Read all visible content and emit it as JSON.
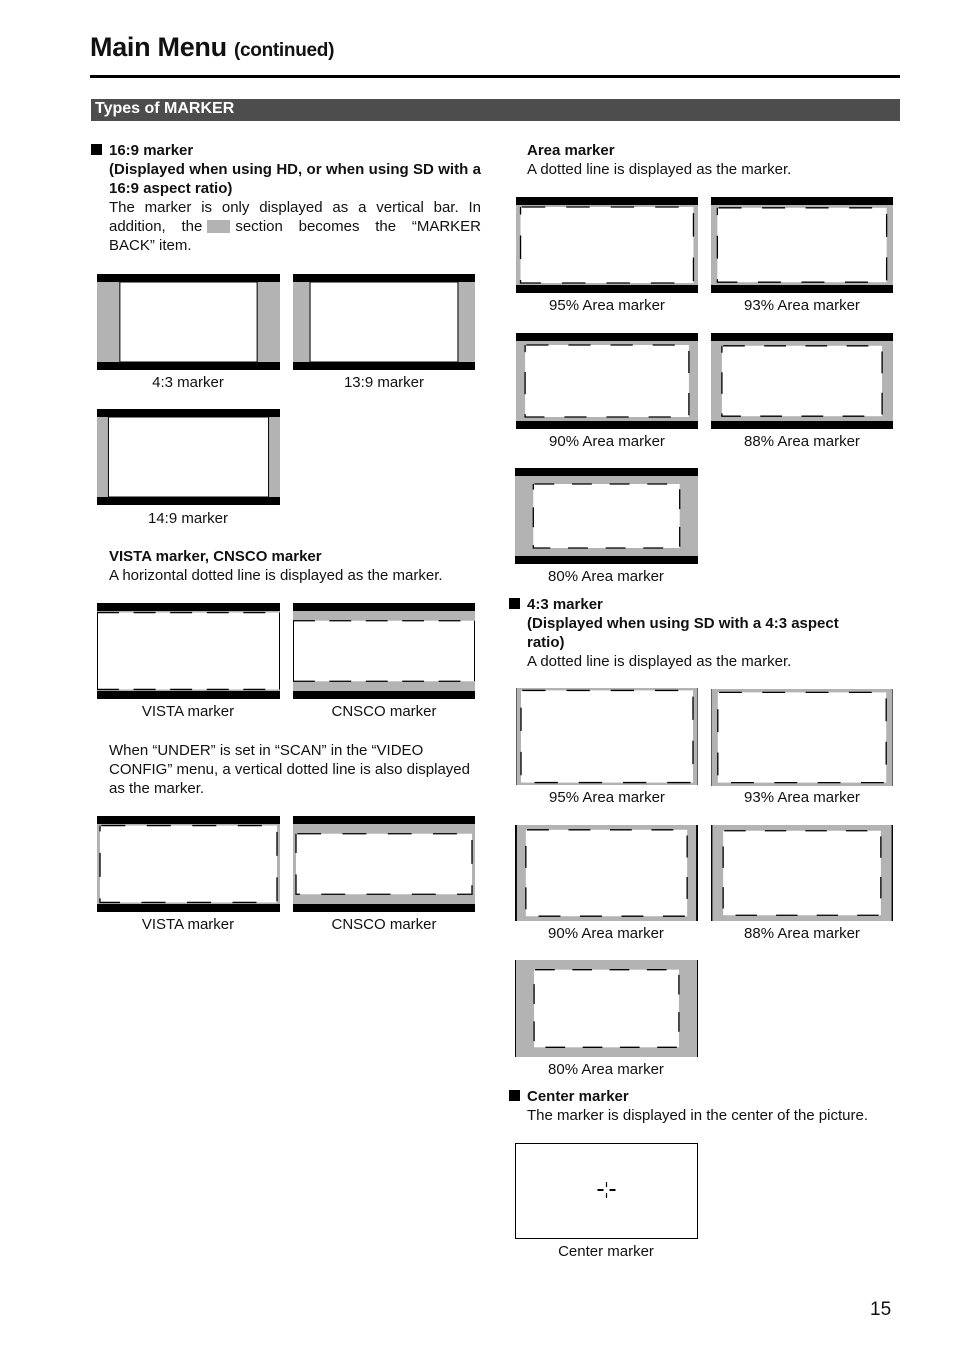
{
  "header": {
    "title": "Main Menu",
    "subtitle": "(continued)"
  },
  "section": {
    "title": "Types of MARKER"
  },
  "colors": {
    "frame_black": "#000000",
    "marker_back_gray": "#b3b3b3",
    "section_bar": "#4d4d4d"
  },
  "left": {
    "m169": {
      "heading": "16:9 marker",
      "subheading": "(Displayed when using HD, or when using SD with a 16:9 aspect ratio)",
      "desc_part1": "The marker is only displayed as a vertical bar. In addition, the",
      "desc_part2": "section becomes the “MARKER BACK” item.",
      "diagrams": [
        {
          "caption": "4:3 marker",
          "type": "pillar",
          "ratio": "4:3"
        },
        {
          "caption": "13:9 marker",
          "type": "pillar",
          "ratio": "13:9"
        },
        {
          "caption": "14:9 marker",
          "type": "pillar",
          "ratio": "14:9"
        }
      ]
    },
    "vista": {
      "heading": "VISTA marker, CNSCO marker",
      "desc": "A horizontal dotted line is displayed as the marker.",
      "diagrams": [
        {
          "caption": "VISTA marker",
          "type": "letterbox",
          "aspect": 1.85
        },
        {
          "caption": "CNSCO marker",
          "type": "letterbox",
          "aspect": 2.35
        }
      ],
      "note": "When “UNDER” is set in “SCAN” in the “VIDEO CONFIG” menu, a vertical dotted line is also displayed as the marker.",
      "diagrams_under": [
        {
          "caption": "VISTA marker",
          "type": "letterbox-box",
          "aspect": 1.85
        },
        {
          "caption": "CNSCO marker",
          "type": "letterbox-box",
          "aspect": 2.35
        }
      ]
    }
  },
  "right": {
    "area": {
      "heading": "Area marker",
      "desc": "A dotted line is displayed as the marker.",
      "diagrams": [
        {
          "caption": "95% Area marker",
          "type": "area169",
          "percent": 95
        },
        {
          "caption": "93% Area marker",
          "type": "area169",
          "percent": 93
        },
        {
          "caption": "90% Area marker",
          "type": "area169",
          "percent": 90
        },
        {
          "caption": "88% Area marker",
          "type": "area169",
          "percent": 88
        },
        {
          "caption": "80% Area marker",
          "type": "area169",
          "percent": 80
        }
      ]
    },
    "m43": {
      "heading": "4:3 marker",
      "subheading": "(Displayed when using SD with a 4:3 aspect ratio)",
      "desc": "A dotted line is displayed as the marker.",
      "diagrams": [
        {
          "caption": "95% Area marker",
          "type": "area43",
          "percent": 95
        },
        {
          "caption": "93% Area marker",
          "type": "area43",
          "percent": 93
        },
        {
          "caption": "90% Area marker",
          "type": "area43",
          "percent": 90
        },
        {
          "caption": "88% Area marker",
          "type": "area43",
          "percent": 88
        },
        {
          "caption": "80% Area marker",
          "type": "area43",
          "percent": 80
        }
      ]
    },
    "center": {
      "heading": "Center marker",
      "desc": "The marker is displayed in the center of the picture.",
      "diagrams": [
        {
          "caption": "Center marker",
          "type": "center"
        }
      ]
    }
  },
  "footer": {
    "page_number": "15"
  }
}
